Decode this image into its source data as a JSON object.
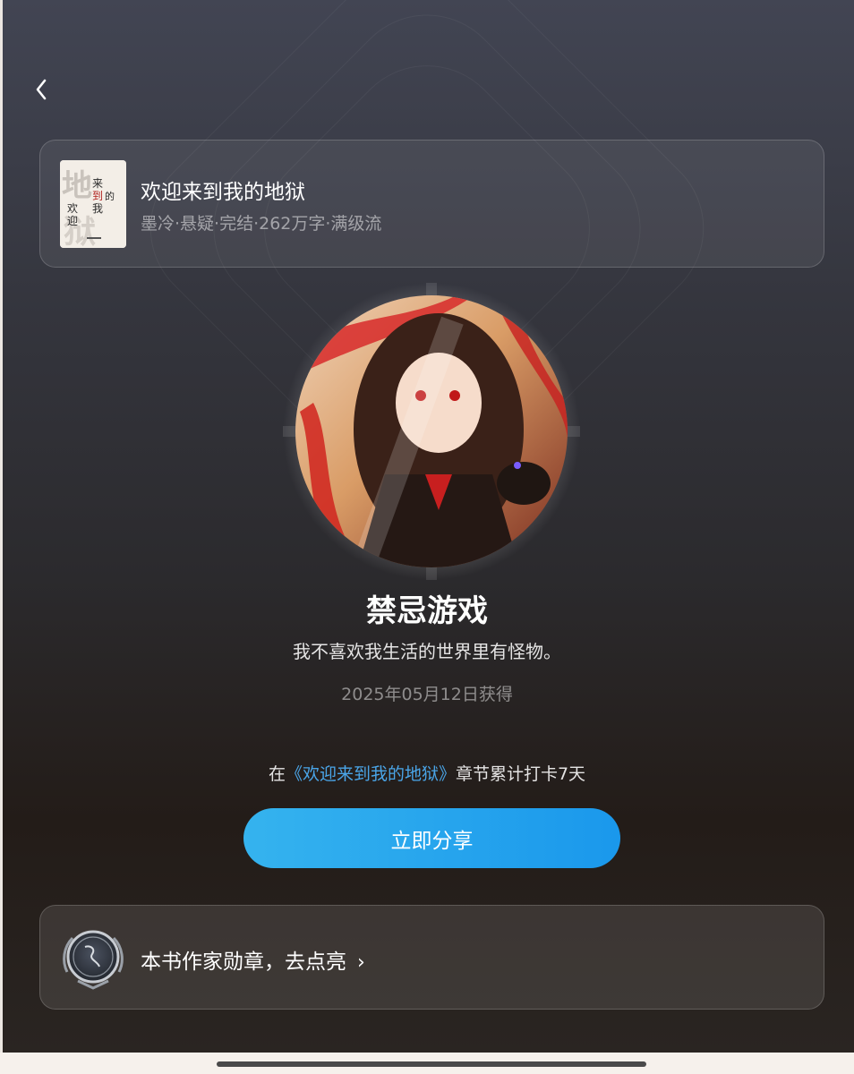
{
  "book": {
    "title": "欢迎来到我的地狱",
    "meta": "墨冷·悬疑·完结·262万字·满级流",
    "cover_text": "欢迎来到我的地狱"
  },
  "medal": {
    "name": "禁忌游戏",
    "description": "我不喜欢我生活的世界里有怪物。",
    "obtained_date": "2025年05月12日获得"
  },
  "condition": {
    "prefix": "在",
    "book_link": "《欢迎来到我的地狱》",
    "suffix": "章节累计打卡7天"
  },
  "share_button": {
    "label": "立即分享"
  },
  "author_medal": {
    "label": "本书作家勋章，去点亮"
  },
  "icons": {
    "back": "chevron-left-icon",
    "chevron": "chevron-right-icon"
  },
  "colors": {
    "accent": "#1a98ec",
    "link": "#4aa5e8"
  }
}
